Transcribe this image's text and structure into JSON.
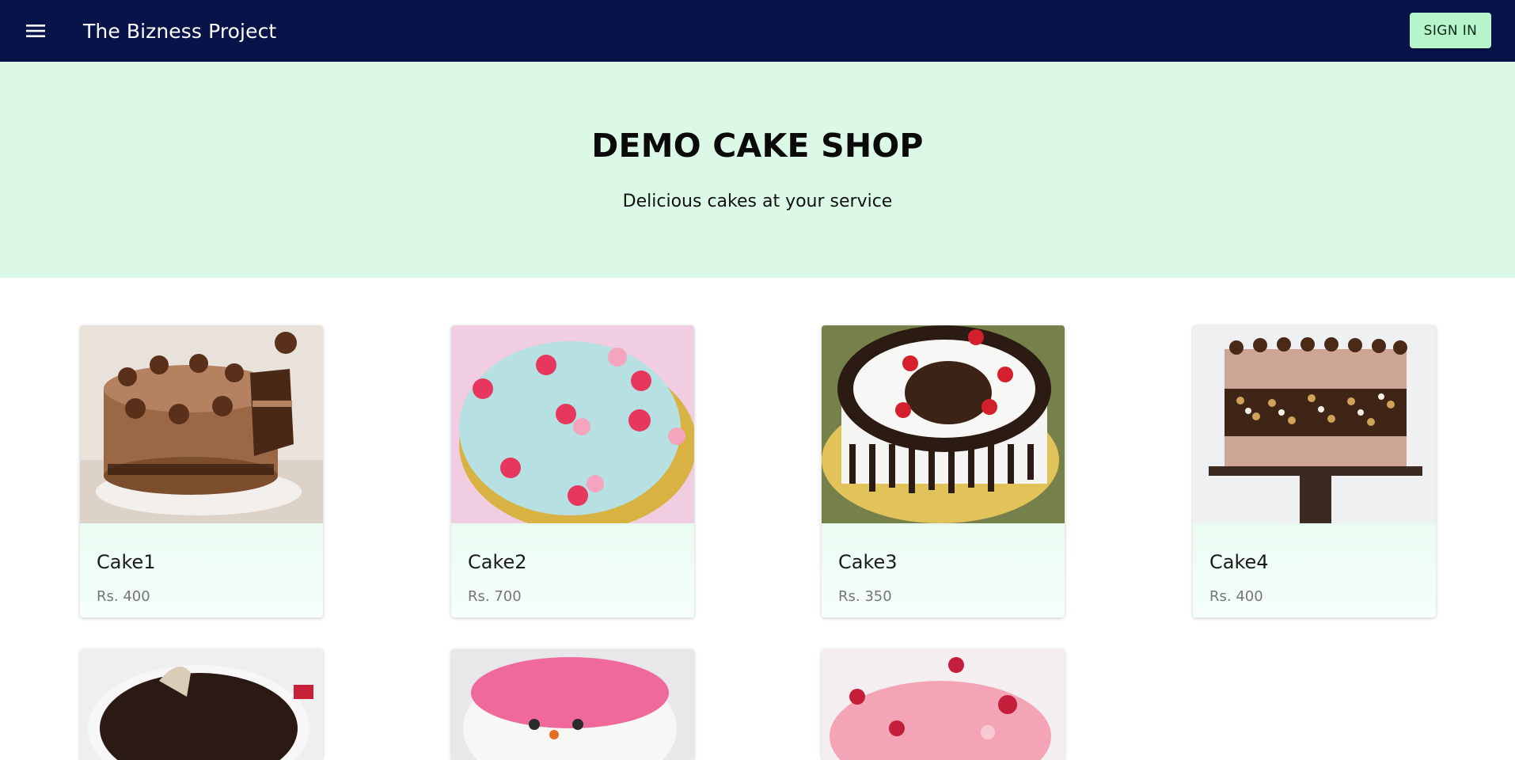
{
  "header": {
    "brand": "The Bizness Project",
    "signin_label": "SIGN IN",
    "menu_icon": "menu-icon"
  },
  "hero": {
    "title": "DEMO CAKE SHOP",
    "subtitle": "Delicious cakes at your service"
  },
  "products": [
    {
      "name": "Cake1",
      "price": "Rs. 400",
      "image": "chocolate-cake-image"
    },
    {
      "name": "Cake2",
      "price": "Rs. 700",
      "image": "floral-blue-cake-image"
    },
    {
      "name": "Cake3",
      "price": "Rs. 350",
      "image": "black-forest-cake-image"
    },
    {
      "name": "Cake4",
      "price": "Rs. 400",
      "image": "sprinkle-fault-line-cake-image"
    }
  ],
  "partial_products": [
    {
      "image": "chocolate-truffle-cake-image"
    },
    {
      "image": "pink-face-cake-image"
    },
    {
      "image": "strawberry-cake-image"
    }
  ],
  "colors": {
    "appbar": "#08134a",
    "hero_bg": "#dcf8e7",
    "signin_bg": "#b6f5cb",
    "card_body": "#f3fdf8",
    "price_text": "#767676"
  }
}
